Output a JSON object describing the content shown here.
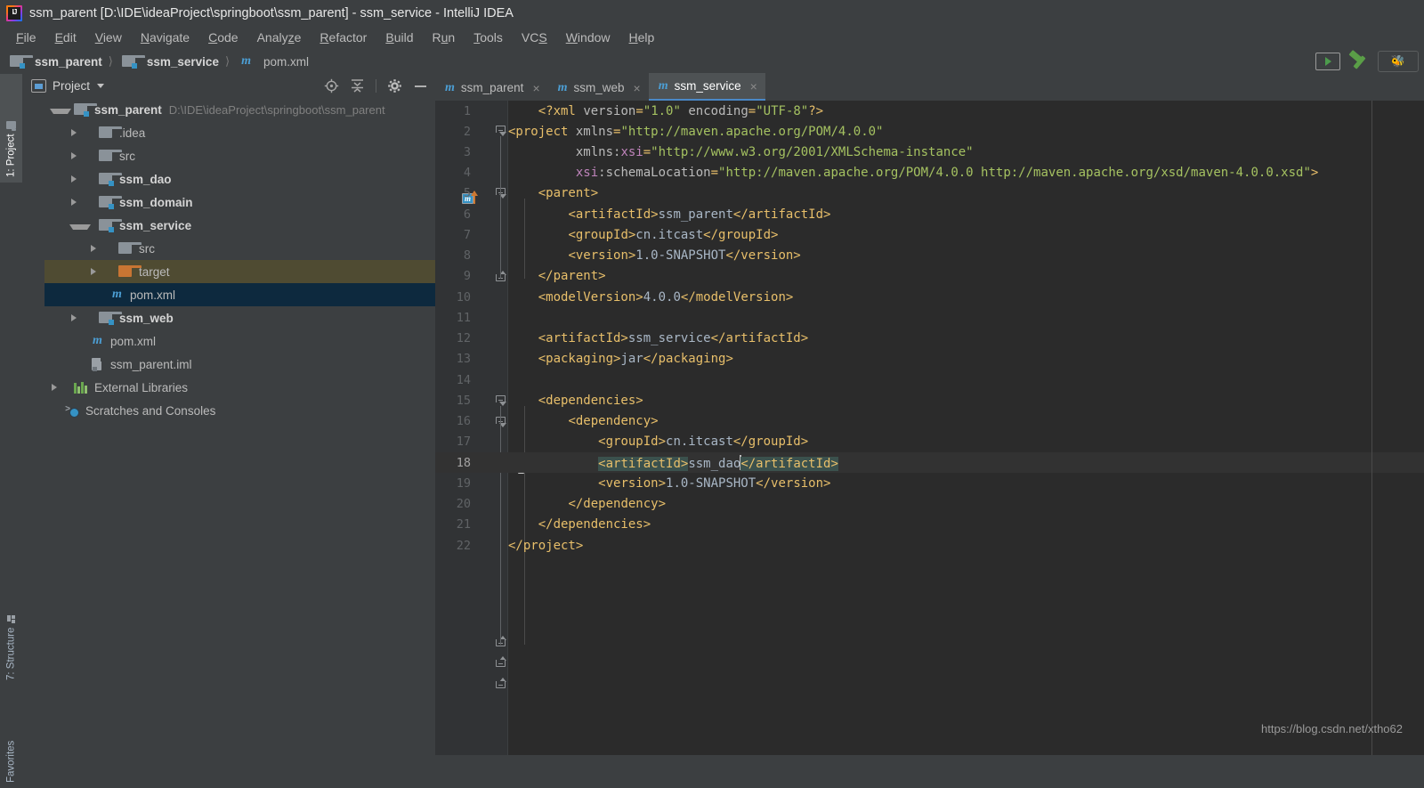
{
  "window": {
    "title": "ssm_parent [D:\\IDE\\ideaProject\\springboot\\ssm_parent] - ssm_service - IntelliJ IDEA",
    "app_icon": "intellij-idea-logo"
  },
  "menubar": {
    "items": [
      {
        "label": "File",
        "mnemonic": "F"
      },
      {
        "label": "Edit",
        "mnemonic": "E"
      },
      {
        "label": "View",
        "mnemonic": "V"
      },
      {
        "label": "Navigate",
        "mnemonic": "N"
      },
      {
        "label": "Code",
        "mnemonic": "C"
      },
      {
        "label": "Analyze",
        "mnemonic": "z"
      },
      {
        "label": "Refactor",
        "mnemonic": "R"
      },
      {
        "label": "Build",
        "mnemonic": "B"
      },
      {
        "label": "Run",
        "mnemonic": "u"
      },
      {
        "label": "Tools",
        "mnemonic": "T"
      },
      {
        "label": "VCS",
        "mnemonic": "S"
      },
      {
        "label": "Window",
        "mnemonic": "W"
      },
      {
        "label": "Help",
        "mnemonic": "H"
      }
    ]
  },
  "breadcrumb": {
    "items": [
      {
        "label": "ssm_parent",
        "icon": "module-folder-icon",
        "bold": true
      },
      {
        "label": "ssm_service",
        "icon": "module-folder-icon",
        "bold": true
      },
      {
        "label": "pom.xml",
        "icon": "maven-m-icon",
        "bold": false
      }
    ],
    "separator": "〉"
  },
  "toolbar_right": {
    "run_config_label": "",
    "icons": [
      "run-configuration-icon",
      "build-hammer-icon",
      "ant-build-icon"
    ]
  },
  "tool_strip_left": {
    "tabs": [
      {
        "label": "1: Project",
        "icon": "project-folder-icon",
        "active": true
      },
      {
        "label": "7: Structure",
        "icon": "structure-icon",
        "active": false
      },
      {
        "label": "Favorites",
        "icon": "",
        "active": false
      }
    ]
  },
  "project_panel": {
    "title": "Project",
    "title_icon": "project-view-icon",
    "caret": "chevron-down-icon",
    "header_icons": [
      {
        "name": "locate-target-icon"
      },
      {
        "name": "collapse-all-icon"
      },
      {
        "name": "gear-settings-icon"
      },
      {
        "name": "hide-minimize-icon"
      }
    ],
    "tree": [
      {
        "label": "ssm_parent",
        "path": "D:\\IDE\\ideaProject\\springboot\\ssm_parent",
        "indent": 0,
        "arrow": "down",
        "icon": "module-folder-icon",
        "bold": true,
        "state": "normal"
      },
      {
        "label": ".idea",
        "path": "",
        "indent": 1,
        "arrow": "right",
        "icon": "folder-icon",
        "bold": false,
        "state": "normal"
      },
      {
        "label": "src",
        "path": "",
        "indent": 1,
        "arrow": "right",
        "icon": "folder-icon",
        "bold": false,
        "state": "normal"
      },
      {
        "label": "ssm_dao",
        "path": "",
        "indent": 1,
        "arrow": "right",
        "icon": "module-folder-icon",
        "bold": true,
        "state": "normal"
      },
      {
        "label": "ssm_domain",
        "path": "",
        "indent": 1,
        "arrow": "right",
        "icon": "module-folder-icon",
        "bold": true,
        "state": "normal"
      },
      {
        "label": "ssm_service",
        "path": "",
        "indent": 1,
        "arrow": "down",
        "icon": "module-folder-icon",
        "bold": true,
        "state": "normal"
      },
      {
        "label": "src",
        "path": "",
        "indent": 2,
        "arrow": "right",
        "icon": "folder-icon",
        "bold": false,
        "state": "normal"
      },
      {
        "label": "target",
        "path": "",
        "indent": 2,
        "arrow": "right",
        "icon": "excluded-folder-icon",
        "bold": false,
        "state": "highlighted"
      },
      {
        "label": "pom.xml",
        "path": "",
        "indent": 2,
        "arrow": "none",
        "icon": "maven-m-icon",
        "bold": false,
        "state": "selected"
      },
      {
        "label": "ssm_web",
        "path": "",
        "indent": 1,
        "arrow": "right",
        "icon": "module-folder-icon",
        "bold": true,
        "state": "normal"
      },
      {
        "label": "pom.xml",
        "path": "",
        "indent": 1,
        "arrow": "none",
        "icon": "maven-m-icon",
        "bold": false,
        "state": "normal"
      },
      {
        "label": "ssm_parent.iml",
        "path": "",
        "indent": 1,
        "arrow": "none",
        "icon": "iml-file-icon",
        "bold": false,
        "state": "normal"
      },
      {
        "label": "External Libraries",
        "path": "",
        "indent": 0,
        "arrow": "right",
        "icon": "libraries-icon",
        "bold": false,
        "state": "normal"
      },
      {
        "label": "Scratches and Consoles",
        "path": "",
        "indent": 0,
        "arrow": "none",
        "icon": "scratches-icon",
        "bold": false,
        "state": "normal"
      }
    ]
  },
  "editor": {
    "tabs": [
      {
        "label": "ssm_parent",
        "icon": "maven-m-icon",
        "active": false,
        "close": "×"
      },
      {
        "label": "ssm_web",
        "icon": "maven-m-icon",
        "active": false,
        "close": "×"
      },
      {
        "label": "ssm_service",
        "icon": "maven-m-icon",
        "active": true,
        "close": "×"
      }
    ],
    "current_line": 18,
    "file_type": "xml",
    "lines": [
      {
        "n": 1,
        "text": "    <?xml version=\"1.0\" encoding=\"UTF-8\"?>"
      },
      {
        "n": 2,
        "text": "<project xmlns=\"http://maven.apache.org/POM/4.0.0\""
      },
      {
        "n": 3,
        "text": "         xmlns:xsi=\"http://www.w3.org/2001/XMLSchema-instance\""
      },
      {
        "n": 4,
        "text": "         xsi:schemaLocation=\"http://maven.apache.org/POM/4.0.0 http://maven.apache.org/xsd/maven-4.0.0.xsd\">"
      },
      {
        "n": 5,
        "text": "    <parent>"
      },
      {
        "n": 6,
        "text": "        <artifactId>ssm_parent</artifactId>"
      },
      {
        "n": 7,
        "text": "        <groupId>cn.itcast</groupId>"
      },
      {
        "n": 8,
        "text": "        <version>1.0-SNAPSHOT</version>"
      },
      {
        "n": 9,
        "text": "    </parent>"
      },
      {
        "n": 10,
        "text": "    <modelVersion>4.0.0</modelVersion>"
      },
      {
        "n": 11,
        "text": ""
      },
      {
        "n": 12,
        "text": "    <artifactId>ssm_service</artifactId>"
      },
      {
        "n": 13,
        "text": "    <packaging>jar</packaging>"
      },
      {
        "n": 14,
        "text": ""
      },
      {
        "n": 15,
        "text": "    <dependencies>"
      },
      {
        "n": 16,
        "text": "        <dependency>"
      },
      {
        "n": 17,
        "text": "            <groupId>cn.itcast</groupId>"
      },
      {
        "n": 18,
        "text": "            <artifactId>ssm_dao</artifactId>"
      },
      {
        "n": 19,
        "text": "            <version>1.0-SNAPSHOT</version>"
      },
      {
        "n": 20,
        "text": "        </dependency>"
      },
      {
        "n": 21,
        "text": "    </dependencies>"
      },
      {
        "n": 22,
        "text": "</project>"
      }
    ],
    "gutter_markers": [
      {
        "line": 5,
        "name": "maven-parent-navigate-icon"
      },
      {
        "line": 18,
        "name": "intention-bulb-icon"
      }
    ]
  },
  "watermark": {
    "text": "https://blog.csdn.net/xtho62"
  },
  "colors": {
    "window_bg": "#3c3f41",
    "editor_bg": "#2b2b2b",
    "gutter_bg": "#313335",
    "selection_blue": "#0d293e",
    "excluded_olive": "#4f4b32",
    "tag_orange": "#e8bf6a",
    "string_green": "#a5c261",
    "namespace_purple": "#bf84bb",
    "text_grey": "#a9b7c6",
    "tab_accent": "#4a88c7",
    "match_tag_teal": "#3b514d"
  }
}
